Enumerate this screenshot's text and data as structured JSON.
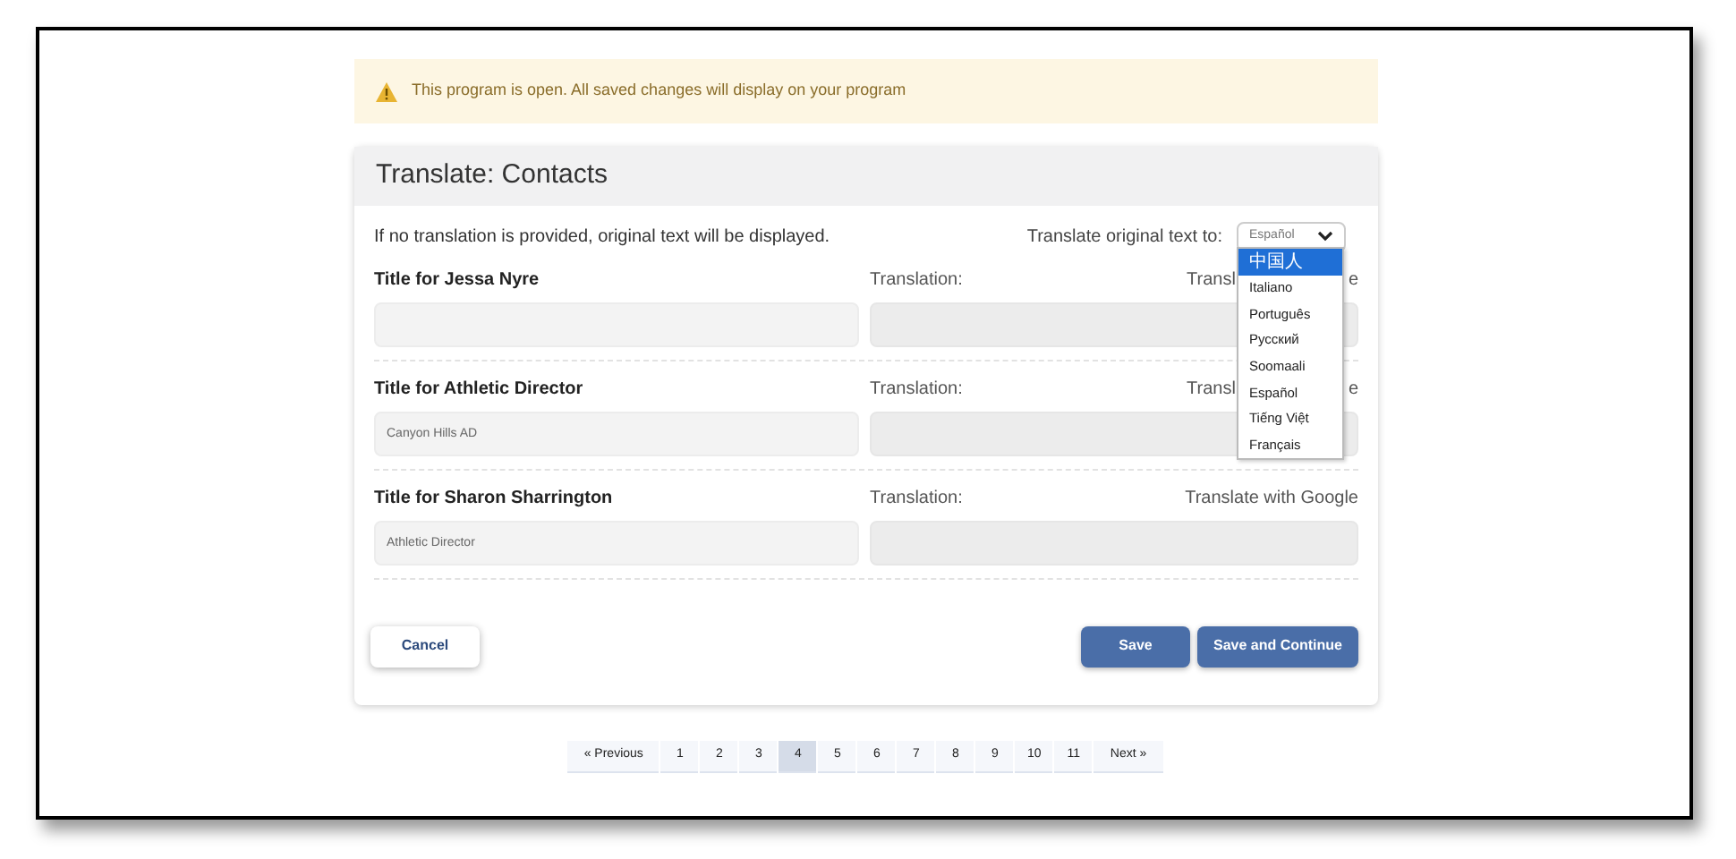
{
  "banner": {
    "text": "This program is open. All saved changes will display on your program"
  },
  "card": {
    "title": "Translate: Contacts",
    "note": "If no translation is provided, original text will be displayed.",
    "language_label": "Translate original text to:",
    "language_select": {
      "value": "Español",
      "expanded": true,
      "options": [
        {
          "label": "中国人",
          "highlighted": true
        },
        {
          "label": "Italiano",
          "highlighted": false
        },
        {
          "label": "Português",
          "highlighted": false
        },
        {
          "label": "Русский",
          "highlighted": false
        },
        {
          "label": "Soomaali",
          "highlighted": false
        },
        {
          "label": "Español",
          "highlighted": false
        },
        {
          "label": "Tiếng Việt",
          "highlighted": false
        },
        {
          "label": "Français",
          "highlighted": false
        }
      ]
    },
    "fields": [
      {
        "title": "Title for Jessa Nyre",
        "translation_label": "Translation:",
        "google_link": "Transl",
        "google_link_tail": "e"
      },
      {
        "title": "Title for Athletic Director",
        "original": "Canyon Hills AD",
        "translation_label": "Translation:",
        "google_link": "Transl",
        "google_link_tail": "e"
      },
      {
        "title": "Title for Sharon Sharrington",
        "original": "Athletic Director",
        "translation_label": "Translation:",
        "google_link": "Translate with Google"
      }
    ],
    "buttons": {
      "cancel": "Cancel",
      "save": "Save",
      "save_continue": "Save and Continue"
    }
  },
  "pagination": [
    {
      "label": "« Previous",
      "selected": false
    },
    {
      "label": "1",
      "selected": false
    },
    {
      "label": "2",
      "selected": false
    },
    {
      "label": "3",
      "selected": false
    },
    {
      "label": "4",
      "selected": true
    },
    {
      "label": "5",
      "selected": false
    },
    {
      "label": "6",
      "selected": false
    },
    {
      "label": "7",
      "selected": false
    },
    {
      "label": "8",
      "selected": false
    },
    {
      "label": "9",
      "selected": false
    },
    {
      "label": "10",
      "selected": false
    },
    {
      "label": "11",
      "selected": false
    },
    {
      "label": "Next »",
      "selected": false
    }
  ]
}
